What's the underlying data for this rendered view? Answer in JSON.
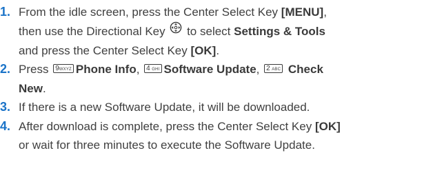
{
  "steps": [
    {
      "number": "1.",
      "t1": "From the idle screen, press the Center Select Key ",
      "menu_key": "[MENU]",
      "t2": ",",
      "t3": "then use the Directional Key ",
      "icon": "directional-key-icon",
      "t4": " to select ",
      "settings": "Settings & Tools",
      "t5": "and press the Center Select Key ",
      "ok_key": "[OK]",
      "t6": "."
    },
    {
      "number": "2.",
      "t1": "Press ",
      "key1_digit": "9",
      "key1_letters": "WXYZ",
      "phone_info": "Phone Info",
      "t2": ", ",
      "key2_digit": "4",
      "key2_letters": "GHI",
      "software_update": "Software Update",
      "t3": ", ",
      "key3_digit": "2",
      "key3_letters": "ABC",
      "check_new_a": "Check",
      "check_new_b": "New",
      "t4": "."
    },
    {
      "number": "3.",
      "text": "If there is a new Software Update, it will be downloaded."
    },
    {
      "number": "4.",
      "t1": "After download is complete, press the Center Select Key ",
      "ok_key": "[OK]",
      "t2": "or wait for three minutes to execute the Software Update."
    }
  ],
  "colors": {
    "number": "#1a73c8",
    "text": "#404040"
  }
}
